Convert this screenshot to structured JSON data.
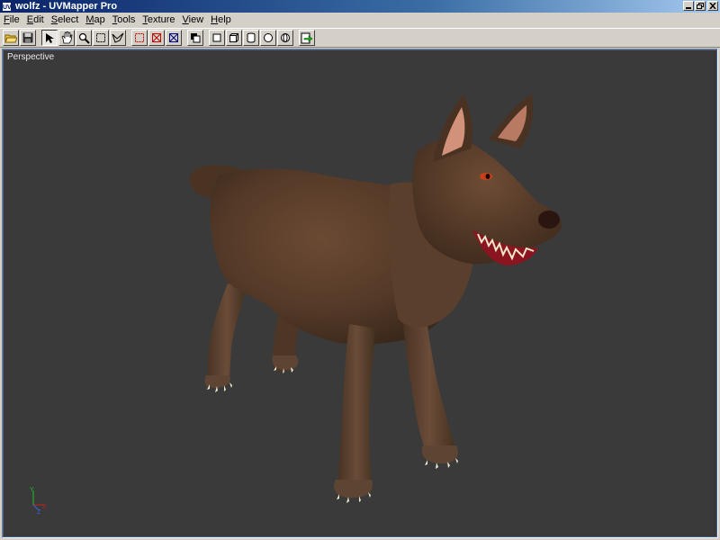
{
  "window": {
    "app_icon_text": "UV",
    "title": "wolfz - UVMapper Pro"
  },
  "menu": [
    "File",
    "Edit",
    "Select",
    "Map",
    "Tools",
    "Texture",
    "View",
    "Help"
  ],
  "toolbar": {
    "buttons": [
      {
        "name": "open-icon"
      },
      {
        "name": "save-icon"
      },
      {
        "name": "pointer-icon",
        "pressed": true
      },
      {
        "name": "hand-pan-icon"
      },
      {
        "name": "zoom-icon"
      },
      {
        "name": "rect-select-icon"
      },
      {
        "name": "lasso-select-icon"
      },
      {
        "name": "select-all-icon"
      },
      {
        "name": "deselect-icon"
      },
      {
        "name": "invert-select-icon"
      },
      {
        "name": "copy-icon"
      },
      {
        "name": "box-map-icon"
      },
      {
        "name": "cube-map-icon"
      },
      {
        "name": "cylinder-map-icon"
      },
      {
        "name": "sphere-map-icon"
      },
      {
        "name": "rotate-map-icon"
      },
      {
        "name": "export-icon"
      }
    ]
  },
  "viewport": {
    "label": "Perspective",
    "background": "#3a3a3a",
    "model_color": "#5a3f2c"
  }
}
